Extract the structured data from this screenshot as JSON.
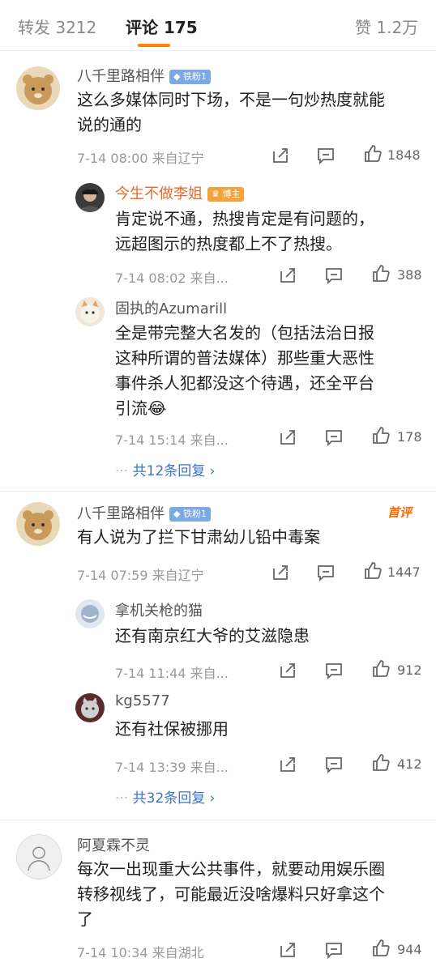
{
  "tabs": {
    "repost": "转发 3212",
    "comments": "评论 175",
    "likes": "赞 1.2万"
  },
  "comments": [
    {
      "name": "八千里路相伴",
      "badge": "铁粉1",
      "hot": "",
      "text": [
        "这么多媒体同时下场，不是一句炒热度就能",
        "说的通的"
      ],
      "meta": "7-14 08:00  来自辽宁",
      "likes": "1848"
    },
    {
      "name": "八千里路相伴",
      "badge": "铁粉1",
      "hot": "首评",
      "text": [
        "有人说为了拦下甘肃幼儿铅中毒案"
      ],
      "meta": "7-14 07:59  来自辽宁",
      "likes": "1447"
    },
    {
      "name": "阿夏霖不灵",
      "badge": "",
      "hot": "",
      "text": [
        "每次一出现重大公共事件，就要动用娱乐圈",
        "转移视线了，可能最近没啥爆料只好拿这个",
        "了"
      ],
      "meta": "7-14 10:34  来自湖北",
      "likes": "944"
    }
  ],
  "replies": [
    {
      "name": "今生不做李姐",
      "badge": "博主",
      "text": [
        "肯定说不通，热搜肯定是有问题的，",
        "远超图示的热度都上不了热搜。"
      ],
      "meta": "7-14 08:02  来自...",
      "likes": "388"
    },
    {
      "name": "固执的Azumarill",
      "badge": "",
      "text": [
        "全是带完整大名发的（包括法治日报",
        "这种所谓的普法媒体）那些重大恶性",
        "事件杀人犯都没这个待遇，还全平台",
        "引流😂"
      ],
      "meta": "7-14 15:14  来自...",
      "likes": "178"
    },
    {
      "name": "拿机关枪的猫",
      "badge": "",
      "text": [
        "还有南京红大爷的艾滋隐患"
      ],
      "meta": "7-14 11:44  来自...",
      "likes": "912"
    },
    {
      "name": "kg5577",
      "badge": "",
      "text": [
        "还有社保被挪用"
      ],
      "meta": "7-14 13:39  来自...",
      "likes": "412"
    }
  ],
  "more_replies": [
    "共12条回复 ›",
    "共32条回复 ›"
  ],
  "icons": {
    "repost": "repost-icon",
    "comment": "comment-icon",
    "like": "thumbs-up-icon"
  },
  "colors": {
    "accent": "#ff8200",
    "link": "#3b74c4",
    "orange_name": "#e86a2a"
  }
}
